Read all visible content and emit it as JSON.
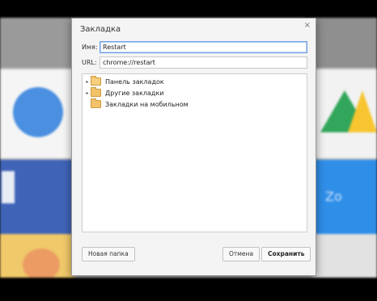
{
  "dialog": {
    "title": "Закладка",
    "close_label": "×",
    "name_label": "Имя:",
    "name_value": "Restart",
    "url_label": "URL:",
    "url_value": "chrome://restart"
  },
  "tree": {
    "items": [
      {
        "label": "Панель закладок",
        "expander": "▸",
        "selected": true
      },
      {
        "label": "Другие закладки",
        "expander": "▸",
        "selected": false
      },
      {
        "label": "Закладки на мобильном",
        "expander": "",
        "selected": false
      }
    ]
  },
  "buttons": {
    "new_folder": "Новая папка",
    "cancel": "Отмена",
    "save": "Сохранить"
  },
  "background": {
    "tile_text": "Zo"
  },
  "colors": {
    "folder": "#f2c26b",
    "focus_border": "#6fa0e6",
    "dialog_bg": "#f4f4f4"
  }
}
